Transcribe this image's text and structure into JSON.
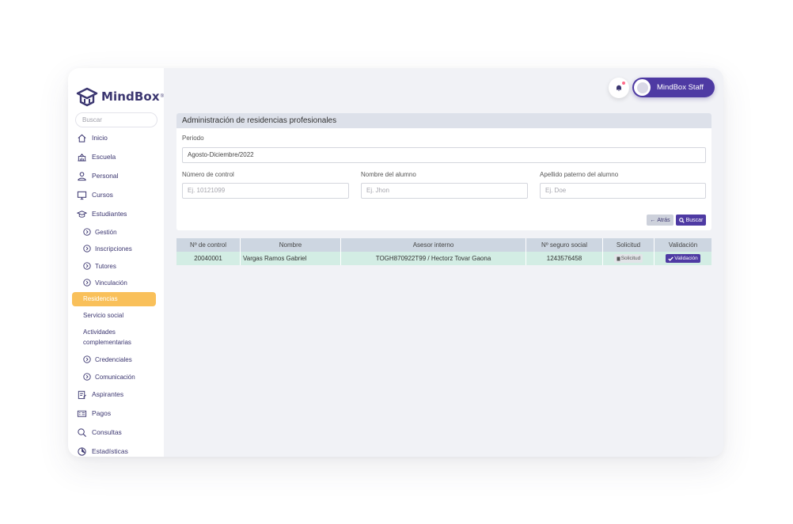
{
  "brand": {
    "name": "MindBox",
    "reg": "®"
  },
  "sidebar": {
    "search_placeholder": "Buscar",
    "items": [
      {
        "label": "Inicio",
        "icon": "home-icon"
      },
      {
        "label": "Escuela",
        "icon": "school-icon"
      },
      {
        "label": "Personal",
        "icon": "user-icon"
      },
      {
        "label": "Cursos",
        "icon": "monitor-icon"
      },
      {
        "label": "Estudiantes",
        "icon": "graduation-cap-icon"
      }
    ],
    "student_sub": [
      {
        "label": "Gestión"
      },
      {
        "label": "Inscripciones"
      },
      {
        "label": "Tutores"
      },
      {
        "label": "Vinculación"
      }
    ],
    "active": "Residencias",
    "plain": {
      "servicio": "Servicio social",
      "actividades_1": "Actividades",
      "actividades_2": "complementarias"
    },
    "student_sub2": [
      {
        "label": "Credenciales"
      },
      {
        "label": "Comunicación"
      }
    ],
    "items2": [
      {
        "label": "Aspirantes",
        "icon": "clipboard-icon"
      },
      {
        "label": "Pagos",
        "icon": "card-icon"
      },
      {
        "label": "Consultas",
        "icon": "search-icon"
      },
      {
        "label": "Estadísticas",
        "icon": "pie-chart-icon"
      }
    ]
  },
  "header": {
    "user_name": "MindBox Staff"
  },
  "card": {
    "title": "Administración de residencias profesionales",
    "periodo_label": "Periodo",
    "periodo_value": "Agosto-Diciembre/2022",
    "control_label": "Número de control",
    "control_placeholder": "Ej. 10121099",
    "nombre_label": "Nombre del alumno",
    "nombre_placeholder": "Ej. Jhon",
    "apellido_label": "Apellido paterno del alumno",
    "apellido_placeholder": "Ej. Doe",
    "back_label": "Atrás",
    "search_label": "Buscar"
  },
  "table": {
    "headers": [
      "Nº de control",
      "Nombre",
      "Asesor interno",
      "Nº seguro social",
      "Solicitud",
      "Validación"
    ],
    "rows": [
      {
        "control": "20040001",
        "nombre": "Vargas Ramos Gabriel",
        "asesor": "TOGH870922T99 / Hectorz Tovar Gaona",
        "nss": "1243576458",
        "solicitud": "Solicitud",
        "validacion": "Validación"
      }
    ]
  },
  "colors": {
    "primary": "#4e3aa3",
    "active": "#f9c05a",
    "row_bg": "#d3ede4",
    "header_bg": "#cdd6e1"
  }
}
